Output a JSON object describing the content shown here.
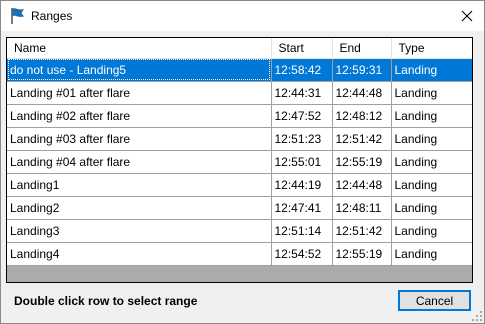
{
  "window": {
    "title": "Ranges",
    "title_icon": "flag-icon",
    "close_icon": "close-icon"
  },
  "table": {
    "columns": [
      "Name",
      "Start",
      "End",
      "Type"
    ],
    "selected_row": 0,
    "rows": [
      {
        "name": "do not use - Landing5",
        "start": "12:58:42",
        "end": "12:59:31",
        "type": "Landing"
      },
      {
        "name": "Landing #01 after flare",
        "start": "12:44:31",
        "end": "12:44:48",
        "type": "Landing"
      },
      {
        "name": "Landing #02 after flare",
        "start": "12:47:52",
        "end": "12:48:12",
        "type": "Landing"
      },
      {
        "name": "Landing #03 after flare",
        "start": "12:51:23",
        "end": "12:51:42",
        "type": "Landing"
      },
      {
        "name": "Landing #04 after flare",
        "start": "12:55:01",
        "end": "12:55:19",
        "type": "Landing"
      },
      {
        "name": "Landing1",
        "start": "12:44:19",
        "end": "12:44:48",
        "type": "Landing"
      },
      {
        "name": "Landing2",
        "start": "12:47:41",
        "end": "12:48:11",
        "type": "Landing"
      },
      {
        "name": "Landing3",
        "start": "12:51:14",
        "end": "12:51:42",
        "type": "Landing"
      },
      {
        "name": "Landing4",
        "start": "12:54:52",
        "end": "12:55:19",
        "type": "Landing"
      }
    ]
  },
  "footer": {
    "hint": "Double click row to select range",
    "cancel_label": "Cancel"
  },
  "colors": {
    "selection": "#0078d7",
    "grid_background": "#ababab",
    "flag_icon": "#1c6fb5"
  }
}
